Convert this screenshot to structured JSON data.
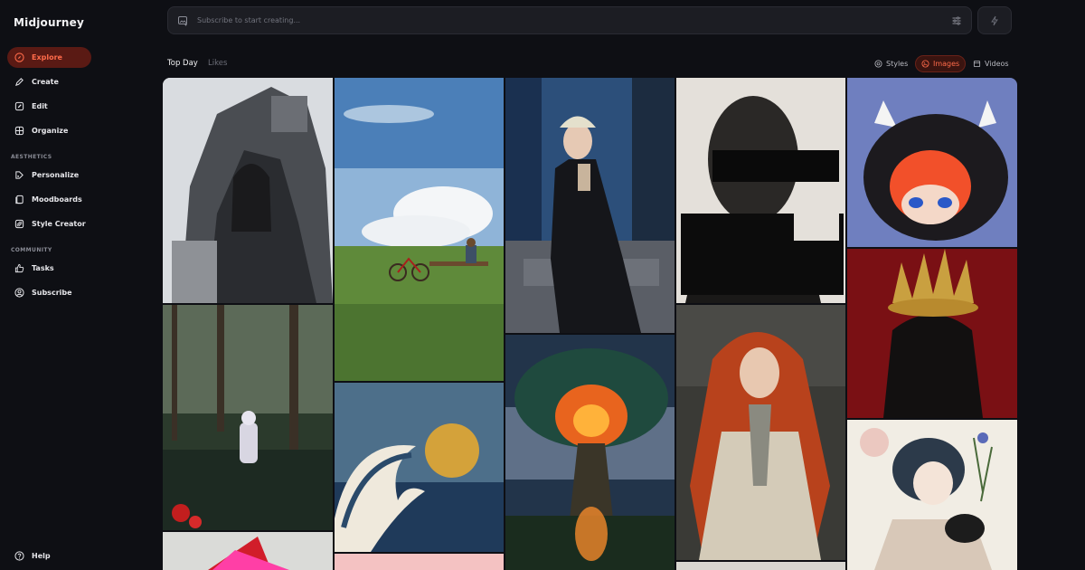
{
  "sidebar": {
    "brand": "Midjourney",
    "main_items": [
      {
        "label": "Explore",
        "icon": "compass-icon"
      },
      {
        "label": "Create",
        "icon": "brush-icon"
      },
      {
        "label": "Edit",
        "icon": "edit-icon"
      },
      {
        "label": "Organize",
        "icon": "grid-icon"
      }
    ],
    "aesthetics_label": "AESTHETICS",
    "aesthetics_items": [
      {
        "label": "Personalize",
        "icon": "palette-icon"
      },
      {
        "label": "Moodboards",
        "icon": "moodboard-icon"
      },
      {
        "label": "Style Creator",
        "icon": "style-creator-icon"
      }
    ],
    "community_label": "COMMUNITY",
    "community_items": [
      {
        "label": "Tasks",
        "icon": "thumbs-up-icon"
      },
      {
        "label": "Subscribe",
        "icon": "user-circle-icon"
      }
    ],
    "help_label": "Help"
  },
  "search": {
    "placeholder": "Subscribe to start creating..."
  },
  "tabs": {
    "top_day": "Top Day",
    "likes": "Likes"
  },
  "filters": {
    "styles": "Styles",
    "images": "Images",
    "videos": "Videos"
  },
  "colors": {
    "accent": "#ff6b4a",
    "background": "#0e0f14",
    "panel": "#1c1d23"
  }
}
